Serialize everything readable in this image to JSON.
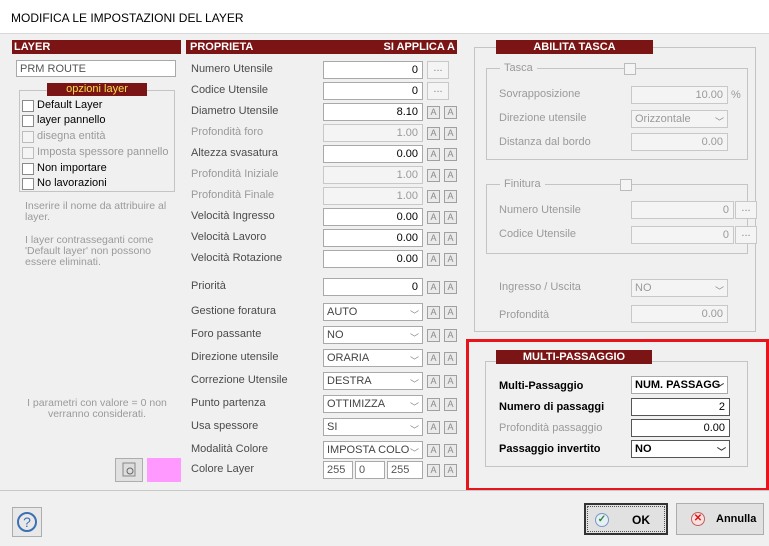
{
  "window": {
    "title": "MODIFICA LE IMPOSTAZIONI DEL LAYER"
  },
  "layer_col": {
    "header": "LAYER",
    "name_value": "PRM ROUTE",
    "options_title": "opzioni layer",
    "options": [
      {
        "label": "Default Layer",
        "enabled": true
      },
      {
        "label": "layer pannello",
        "enabled": true
      },
      {
        "label": "disegna entità",
        "enabled": false
      },
      {
        "label": "Imposta spessore pannello",
        "enabled": false
      },
      {
        "label": "Non importare",
        "enabled": true
      },
      {
        "label": "No lavorazioni",
        "enabled": true
      }
    ],
    "info1": "Inserire il nome da attribuire al layer.",
    "info2": "I layer contrasseganti come 'Default layer' non possono essere eliminati.",
    "info3": "I parametri con valore = 0 non verranno considerati."
  },
  "props": {
    "header": "PROPRIETA",
    "apply_header": "SI APPLICA A",
    "rows": [
      {
        "label": "Numero Utensile",
        "value": "0",
        "dim": false
      },
      {
        "label": "Codice Utensile",
        "value": "0",
        "dim": false
      },
      {
        "label": "Diametro Utensile",
        "value": "8.10",
        "dim": false
      },
      {
        "label": "Profondità foro",
        "value": "1.00",
        "dim": true
      },
      {
        "label": "Altezza svasatura",
        "value": "0.00",
        "dim": false
      },
      {
        "label": "Profondità Iniziale",
        "value": "1.00",
        "dim": true
      },
      {
        "label": "Profondità Finale",
        "value": "1.00",
        "dim": true
      },
      {
        "label": "Velocità Ingresso",
        "value": "0.00",
        "dim": false
      },
      {
        "label": "Velocità Lavoro",
        "value": "0.00",
        "dim": false
      },
      {
        "label": "Velocità Rotazione",
        "value": "0.00",
        "dim": false
      },
      {
        "label": "Priorità",
        "value": "0",
        "dim": false
      },
      {
        "label": "Gestione foratura",
        "value": "AUTO",
        "dim": false
      },
      {
        "label": "Foro passante",
        "value": "NO",
        "dim": false
      },
      {
        "label": "Direzione utensile",
        "value": "ORARIA",
        "dim": false
      },
      {
        "label": "Correzione Utensile",
        "value": "DESTRA",
        "dim": false
      },
      {
        "label": "Punto partenza",
        "value": "OTTIMIZZA",
        "dim": false
      },
      {
        "label": "Usa spessore",
        "value": "SI",
        "dim": false
      },
      {
        "label": "Modalità Colore",
        "value": "IMPOSTA COLO",
        "dim": false
      },
      {
        "label": "Colore Layer",
        "value": "",
        "dim": false
      }
    ],
    "dots": "...",
    "color_r": "255",
    "color_g": "0",
    "color_b": "255",
    "swatch_color": "#ff99ff"
  },
  "tasca": {
    "header": "ABILITA TASCA",
    "group_title": "Tasca",
    "sovrapposizione_label": "Sovrapposizione",
    "sovrapposizione_value": "10.00",
    "percent": "%",
    "direzione_label": "Direzione utensile",
    "direzione_value": "Orizzontale",
    "distanza_label": "Distanza dal bordo",
    "distanza_value": "0.00"
  },
  "finitura": {
    "group_title": "Finitura",
    "numero_label": "Numero Utensile",
    "numero_value": "0",
    "codice_label": "Codice Utensile",
    "codice_value": "0",
    "ingresso_label": "Ingresso / Uscita",
    "ingresso_value": "NO",
    "profondita_label": "Profondità",
    "profondita_value": "0.00"
  },
  "multi": {
    "header": "MULTI-PASSAGGIO",
    "mode_label": "Multi-Passaggio",
    "mode_value": "NUM. PASSAGG",
    "count_label": "Numero di passaggi",
    "count_value": "2",
    "depth_label": "Profondità passaggio",
    "depth_value": "0.00",
    "inverted_label": "Passaggio invertito",
    "inverted_value": "NO",
    "highlight_color": "#e8141c"
  },
  "footer": {
    "help_glyph": "?",
    "ok_label": "OK",
    "cancel_label": "Annulla"
  }
}
